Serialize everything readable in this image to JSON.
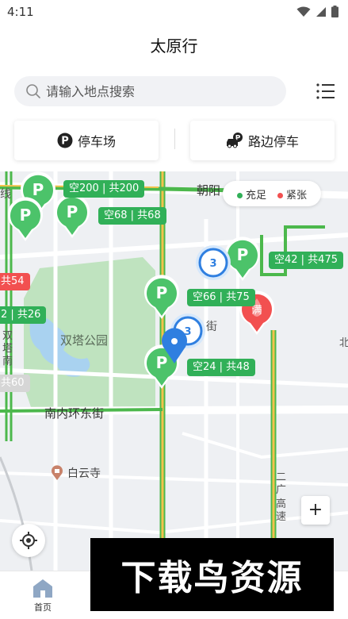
{
  "status_bar": {
    "time": "4:11"
  },
  "app": {
    "title": "太原行"
  },
  "search": {
    "placeholder": "请输入地点搜索"
  },
  "tabs": [
    {
      "label": "停车场",
      "icon": "parking-p-icon"
    },
    {
      "label": "路边停车",
      "icon": "roadside-car-icon"
    }
  ],
  "legend": {
    "items": [
      {
        "label": "充足",
        "color": "#31b058"
      },
      {
        "label": "紧张",
        "color": "#f25050"
      }
    ]
  },
  "map": {
    "road_labels": [
      "朝阳",
      "线",
      "南内环东街",
      "街"
    ],
    "place_labels": [
      "双塔公园",
      "白云寺",
      "双塔南",
      "高速",
      "二广",
      "北"
    ],
    "parking_badges": [
      {
        "text": "空200 | 共200",
        "status": "sufficient"
      },
      {
        "text": "空68 | 共68",
        "status": "sufficient"
      },
      {
        "text": "空42 | 共475",
        "status": "sufficient"
      },
      {
        "text": "空66 | 共75",
        "status": "sufficient"
      },
      {
        "text": "空24 | 共48",
        "status": "sufficient"
      },
      {
        "text": "共54",
        "status": "tight"
      },
      {
        "text": "2 | 共26",
        "status": "sufficient"
      },
      {
        "text": "共60",
        "status": "unknown"
      }
    ],
    "full_pin_label": "满",
    "cluster_count_1": "3",
    "cluster_count_2": "3",
    "zoom_in_label": "+"
  },
  "bottom_nav": {
    "items": [
      {
        "label": "首页",
        "icon": "home-icon",
        "active": true
      }
    ]
  },
  "watermark": {
    "text": "下载鸟资源"
  }
}
